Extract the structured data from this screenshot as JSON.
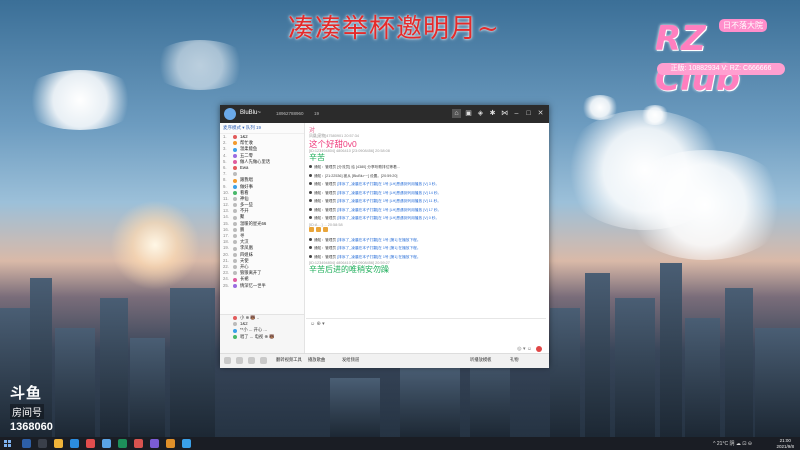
{
  "overlay": {
    "title": "凑凑举杯邀明月~",
    "logo_main": "RZ Club",
    "logo_badge": "日不落大院",
    "logo_bar": "正版: 10882934  V: RZ: C666666",
    "douyu_brand": "斗鱼",
    "douyu_room_label": "房间号",
    "douyu_room": "1368060"
  },
  "app": {
    "user": "BluBlu~",
    "user_id": "18962788960",
    "status": "19",
    "header_icons": [
      "home-icon",
      "message-icon",
      "game-icon",
      "settings-icon",
      "share-icon",
      "minimize-icon",
      "maximize-icon",
      "close-icon"
    ],
    "left_header": "麦序模式 ▾  队列 19",
    "left_tabs": [
      "排麦",
      "管理",
      "设置"
    ],
    "members": [
      {
        "n": "1.",
        "t": "1&2",
        "c": "#e25b5b"
      },
      {
        "n": "2.",
        "t": "帮忙收",
        "c": "#f29a2e"
      },
      {
        "n": "3.",
        "t": "温柔能鱼",
        "c": "#3aa0e8"
      },
      {
        "n": "4.",
        "t": "五二零",
        "c": "#9a6be0"
      },
      {
        "n": "5.",
        "t": "做人先做心里话",
        "c": "#e05c9e"
      },
      {
        "n": "6.",
        "t": "Ewa",
        "c": "#e25b5b"
      },
      {
        "n": "7.",
        "t": "",
        "c": "#bbb"
      },
      {
        "n": "8.",
        "t": "跟我唱",
        "c": "#f29a2e"
      },
      {
        "n": "9.",
        "t": "做好事",
        "c": "#3aa0e8"
      },
      {
        "n": "10.",
        "t": "看看",
        "c": "#48b86a"
      },
      {
        "n": "11.",
        "t": "神仙",
        "c": "#bbb"
      },
      {
        "n": "12.",
        "t": "多一些",
        "c": "#bbb"
      },
      {
        "n": "13.",
        "t": "不开",
        "c": "#bbb"
      },
      {
        "n": "14.",
        "t": "聚",
        "c": "#bbb"
      },
      {
        "n": "15.",
        "t": "温暖的星光66",
        "c": "#bbb"
      },
      {
        "n": "16.",
        "t": "鹏",
        "c": "#bbb"
      },
      {
        "n": "17.",
        "t": "寻",
        "c": "#bbb"
      },
      {
        "n": "18.",
        "t": "大汉",
        "c": "#bbb"
      },
      {
        "n": "19.",
        "t": "李凤凰",
        "c": "#bbb"
      },
      {
        "n": "20.",
        "t": "四姐妹",
        "c": "#bbb"
      },
      {
        "n": "21.",
        "t": "天使",
        "c": "#bbb"
      },
      {
        "n": "22.",
        "t": "开心",
        "c": "#bbb"
      },
      {
        "n": "23.",
        "t": "狼狼离开了",
        "c": "#bbb"
      },
      {
        "n": "24.",
        "t": "长裙",
        "c": "#e05c9e"
      },
      {
        "n": "25.",
        "t": "情深忆一世半",
        "c": "#9a6be0"
      }
    ],
    "footer_members": [
      {
        "n": "",
        "t": "小 ⊕ 🐻 ..",
        "c": "#e25b5b"
      },
      {
        "n": "",
        "t": "1&2",
        "c": "#bbb"
      },
      {
        "n": "",
        "t": "**小 ... 开心 ...",
        "c": "#3aa0e8"
      },
      {
        "n": "",
        "t": "唱了 ... 电视 ⊕ 🐻",
        "c": "#48b86a"
      }
    ],
    "chat": {
      "line_top": "对",
      "meta1": "凤凰[宠物]47580901  20:57:34",
      "msg1": "这个好甜0v0",
      "meta2": "[ID:123494804] 4806410 [23:0908456]  20:58:08",
      "msg2": "辛苦",
      "system_lines": [
        {
          "a": "通知：",
          "b": "管理员 [分流员] 给 [4380] 分享听歌排位等着...",
          "c": ""
        },
        {
          "a": "通知：",
          "b": "[21:22536] 被从 [BluBlu~~] 设置。[20:59:20]",
          "c": ""
        },
        {
          "a": "通知：",
          "b": "管理员 ",
          "c": "[排序了_凌晨在本子打翻]在 1号 [LH]恩遇到列用播放 [V] 3 秒。"
        },
        {
          "a": "通知：",
          "b": "管理员 ",
          "c": "[排序了_凌晨在本子打翻]在 1号 [LH]恩遇到列用播放 [V] 14 秒。"
        },
        {
          "a": "通知：",
          "b": "管理员 ",
          "c": "[排序了_凌晨在本子打翻]在 1号 [LH]恩遇到列用播放 [V] 11 秒。"
        },
        {
          "a": "通知：",
          "b": "管理员 ",
          "c": "[排序了_凌晨在本子打翻]在 1号 [LH]恩遇到列用播放 [V] 17 秒。"
        },
        {
          "a": "通知：",
          "b": "管理员 ",
          "c": "[排序了_凌晨在本子打翻]在 1号 [LH]恩遇到列用播放 [V] 0 秒。"
        }
      ],
      "meta3": "[ID:A ...] ...   20:58:58",
      "system_lines_2": [
        {
          "a": "通知：",
          "b": "管理员 ",
          "c": "[排序了_凌晨在本子打翻]在 1号 [第1] 在播放下程。"
        },
        {
          "a": "通知：",
          "b": "管理员 ",
          "c": "[排序了_凌晨在本子打翻]在 1号 [第1] 在播放下程。"
        },
        {
          "a": "通知：",
          "b": "管理员 ",
          "c": "[排序了_凌晨在本子打翻]在 1号 [第1] 在播放下程。"
        }
      ],
      "meta4": "[ID:123494804] 4806410 [23:0908456]  20:59:27",
      "msg3": "辛苦后进的唯稍安勿躁"
    },
    "input_hint": "☺ ⊕ ▾",
    "send_tools": "◎ ▾ ☺",
    "bottom": {
      "b1": "翻转视频工具",
      "b2": "播放歌曲",
      "b3": "发给频道",
      "b4": "听播放模板",
      "b5": "礼物"
    }
  },
  "taskbar": {
    "tray": "^ 21°C  阴  ☁  ⊡  ⊖",
    "time": "21:00",
    "date": "2021/9/8"
  },
  "colors": {
    "title_red": "#e52a2a",
    "logo_pink": "#ff7fbf",
    "chat_pink": "#ee3a7b",
    "chat_green": "#1eae5a",
    "link_blue": "#2a6fd8"
  }
}
